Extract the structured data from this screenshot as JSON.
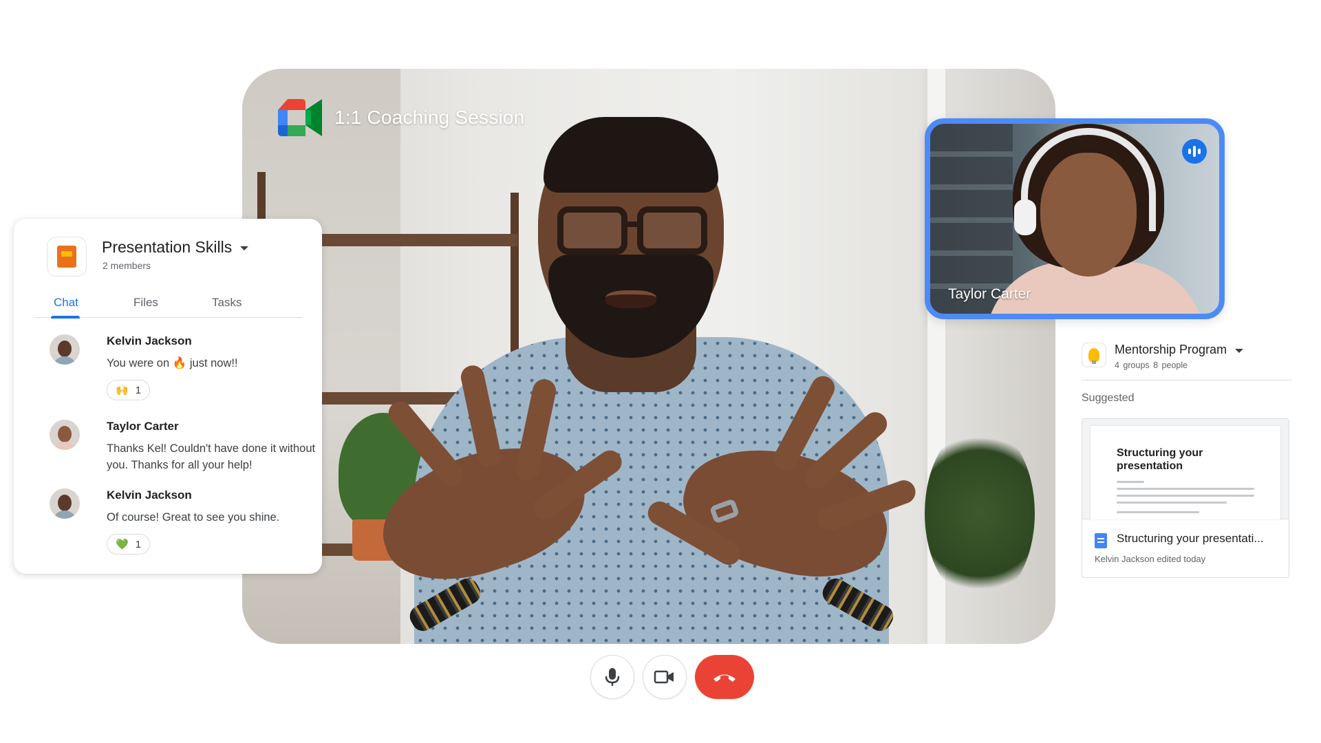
{
  "meeting": {
    "title": "1:1 Coaching Session"
  },
  "participant_tile": {
    "name": "Taylor Carter",
    "speaking_icon": "audio-wave-icon",
    "accent_color": "#4c8bf5"
  },
  "chat_panel": {
    "space_name": "Presentation Skills",
    "space_members": "2 members",
    "tabs": [
      {
        "label": "Chat",
        "active": true
      },
      {
        "label": "Files",
        "active": false
      },
      {
        "label": "Tasks",
        "active": false
      }
    ],
    "messages": [
      {
        "author": "Kelvin Jackson",
        "text_before": "You were on",
        "emoji_inline": "🔥",
        "text_after": "just now!!",
        "reaction_emoji": "🙌",
        "reaction_count": "1"
      },
      {
        "author": "Taylor Carter",
        "text": "Thanks Kel! Couldn't have done it without you. Thanks for all your help!"
      },
      {
        "author": "Kelvin Jackson",
        "text": "Of course! Great to see you shine.",
        "reaction_emoji": "💚",
        "reaction_count": "1"
      }
    ]
  },
  "side_panel": {
    "program_name": "Mentorship Program",
    "program_meta": "4 groups  8 people",
    "suggested_label": "Suggested",
    "doc": {
      "thumbnail_title": "Structuring your presentation",
      "name": "Structuring your presentati...",
      "meta": "Kelvin Jackson edited today"
    }
  },
  "controls": {
    "mic_icon": "microphone-icon",
    "camera_icon": "video-camera-icon",
    "end_icon": "hang-up-icon",
    "end_color": "#ea4335",
    "brand_colors": [
      "#4285f4",
      "#34a853",
      "#fbbc04",
      "#ea4335"
    ]
  }
}
